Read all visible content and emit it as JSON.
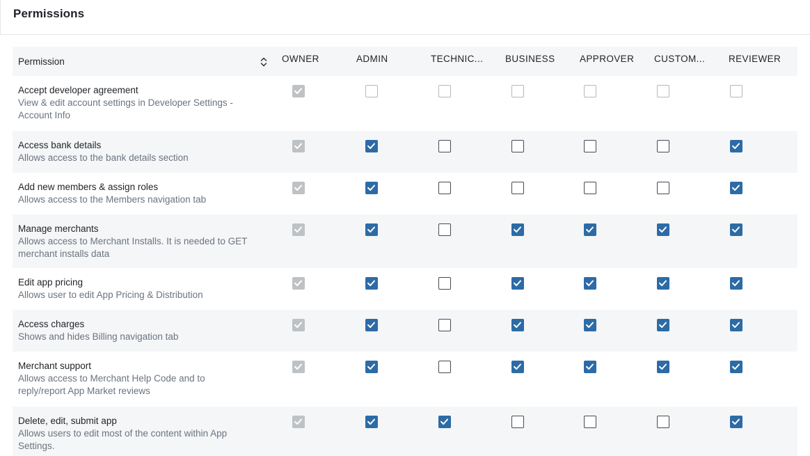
{
  "panel": {
    "title": "Permissions"
  },
  "table": {
    "permission_header": "Permission",
    "columns": [
      "OWNER",
      "ADMIN",
      "TECHNIC...",
      "BUSINESS",
      "APPROVER",
      "CUSTOM...",
      "REVIEWER"
    ],
    "rows": [
      {
        "name": "Accept developer agreement",
        "desc_lines": [
          "View & edit account settings in Developer Settings -",
          "Account Info"
        ],
        "checks": [
          "disabled",
          "empty-light",
          "empty-light",
          "empty-light",
          "empty-light",
          "empty-light",
          "empty-light"
        ]
      },
      {
        "name": "Access bank details",
        "desc_lines": [
          "Allows access to the bank details section"
        ],
        "checks": [
          "disabled",
          "checked",
          "empty",
          "empty",
          "empty",
          "empty",
          "checked"
        ]
      },
      {
        "name": "Add new members & assign roles",
        "desc_lines": [
          "Allows access to the Members navigation tab"
        ],
        "checks": [
          "disabled",
          "checked",
          "empty",
          "empty",
          "empty",
          "empty",
          "checked"
        ]
      },
      {
        "name": "Manage merchants",
        "desc_lines": [
          "Allows access to Merchant Installs. It is needed to GET",
          "merchant installs data"
        ],
        "checks": [
          "disabled",
          "checked",
          "empty",
          "checked",
          "checked",
          "checked",
          "checked"
        ]
      },
      {
        "name": "Edit app pricing",
        "desc_lines": [
          "Allows user to edit App Pricing & Distribution"
        ],
        "checks": [
          "disabled",
          "checked",
          "empty",
          "checked",
          "checked",
          "checked",
          "checked"
        ]
      },
      {
        "name": "Access charges",
        "desc_lines": [
          "Shows and hides Billing navigation tab"
        ],
        "checks": [
          "disabled",
          "checked",
          "empty",
          "checked",
          "checked",
          "checked",
          "checked"
        ]
      },
      {
        "name": "Merchant support",
        "desc_lines": [
          "Allows access to Merchant Help Code and to",
          "reply/report App Market reviews"
        ],
        "checks": [
          "disabled",
          "checked",
          "empty",
          "checked",
          "checked",
          "checked",
          "checked"
        ]
      },
      {
        "name": "Delete, edit, submit app",
        "desc_lines": [
          "Allows users to edit most of the content within App",
          "Settings."
        ],
        "checks": [
          "disabled",
          "checked",
          "checked",
          "empty",
          "empty",
          "empty",
          "checked"
        ]
      }
    ]
  },
  "colors": {
    "accent": "#2d6ba6",
    "disabled": "#bfc2c5",
    "row_shade": "#f5f6f7"
  },
  "icons": {
    "sort": "sort-arrows-icon",
    "check": "checkmark-icon"
  }
}
